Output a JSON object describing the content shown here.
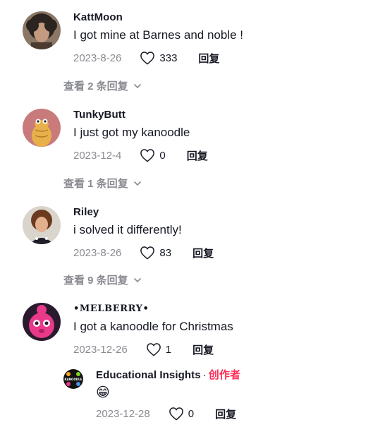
{
  "comments": [
    {
      "username": "KattMoon",
      "text": "I got mine at Barnes and noble !",
      "date": "2023-8-26",
      "likes": "333",
      "reply_label": "回复",
      "view_replies": "查看 2 条回复"
    },
    {
      "username": "TunkyButt",
      "text": "I just got my kanoodle",
      "date": "2023-12-4",
      "likes": "0",
      "reply_label": "回复",
      "view_replies": "查看 1 条回复"
    },
    {
      "username": "Riley",
      "text": "i solved it differently!",
      "date": "2023-8-26",
      "likes": "83",
      "reply_label": "回复",
      "view_replies": "查看 9 条回复"
    },
    {
      "username": "•MELBERRY•",
      "text": "I got a kanoodle for Christmas",
      "date": "2023-12-26",
      "likes": "1",
      "reply_label": "回复"
    }
  ],
  "reply": {
    "username": "Educational Insights",
    "separator": "·",
    "creator_badge": "创作者",
    "text": "😁",
    "date": "2023-12-28",
    "likes": "0",
    "reply_label": "回复",
    "avatar_text": "KANOODLE"
  },
  "colors": {
    "creator": "#fe2c55",
    "muted": "#8a8b91",
    "text": "#161823"
  }
}
